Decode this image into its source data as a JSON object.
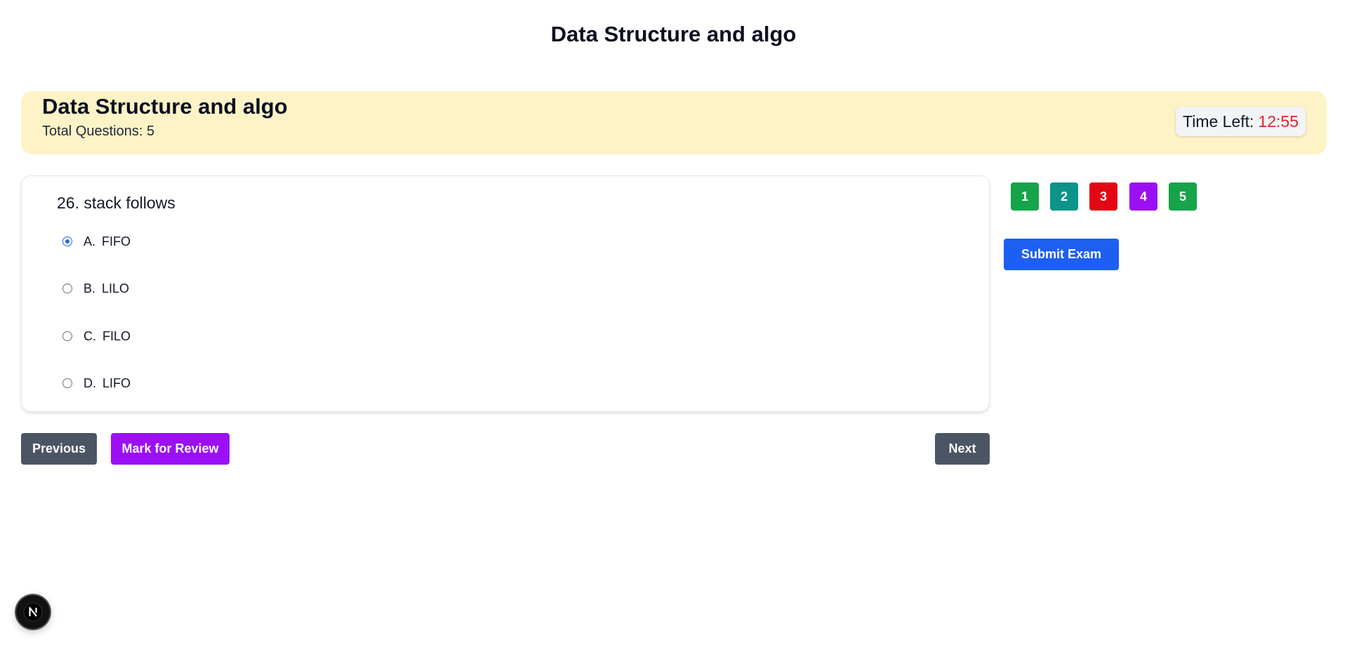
{
  "page": {
    "title": "Data Structure and algo"
  },
  "exam": {
    "title": "Data Structure and algo",
    "total_questions_label": "Total Questions: 5",
    "timer_label": "Time Left:",
    "timer_value": "12:55",
    "timer_value_color": "#dc2626"
  },
  "question": {
    "text": "26. stack follows",
    "options": [
      {
        "letter": "A.",
        "text": "FIFO",
        "selected": true
      },
      {
        "letter": "B.",
        "text": "LILO",
        "selected": false
      },
      {
        "letter": "C.",
        "text": "FILO",
        "selected": false
      },
      {
        "letter": "D.",
        "text": "LIFO",
        "selected": false
      }
    ]
  },
  "question_nav": [
    {
      "label": "1",
      "color": "#16a34a"
    },
    {
      "label": "2",
      "color": "#0d9488"
    },
    {
      "label": "3",
      "color": "#e30613"
    },
    {
      "label": "4",
      "color": "#9b0ff5"
    },
    {
      "label": "5",
      "color": "#16a34a"
    }
  ],
  "buttons": {
    "previous": "Previous",
    "mark_review": "Mark for Review",
    "next": "Next",
    "submit": "Submit Exam"
  },
  "colors": {
    "header_bg": "#fef3c7",
    "secondary_button": "#4b5563",
    "review_button": "#9b0ff5",
    "submit_button": "#1d5ff2",
    "selected_radio": "#2563eb"
  },
  "devtools_badge": {
    "icon": "nextjs-icon",
    "letter": "N"
  }
}
